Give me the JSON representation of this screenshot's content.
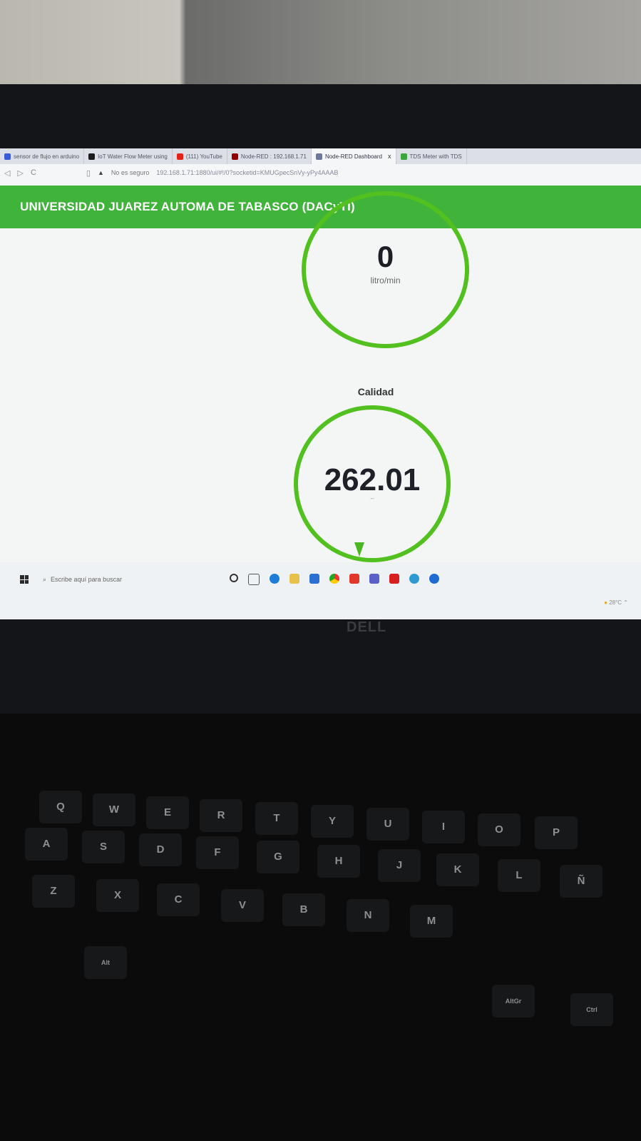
{
  "browser": {
    "tabs": [
      {
        "label": "sensor de flujo en arduino",
        "icon": "grid-icon",
        "color": "#3a5ad9"
      },
      {
        "label": "IoT Water Flow Meter using",
        "icon": "e-icon",
        "color": "#1b1b1b"
      },
      {
        "label": "(111) YouTube",
        "icon": "youtube-icon",
        "color": "#e62117"
      },
      {
        "label": "Node-RED : 192.168.1.71",
        "icon": "nodered-icon",
        "color": "#8f0000"
      },
      {
        "label": "Node-RED Dashboard",
        "icon": "share-icon",
        "color": "#6b7a99"
      },
      {
        "label": "TDS Meter with TDS",
        "icon": "dollar-icon",
        "color": "#3aa53a"
      }
    ],
    "active_tab_close": "x",
    "security_label": "No es seguro",
    "url": "192.168.1.71:1880/ui/#!/0?socketid=KMUGpecSnVy-yPy4AAAB"
  },
  "dashboard": {
    "header_title": "UNIVERSIDAD JUAREZ AUTOMA DE TABASCO (DACyTI)",
    "flow_gauge": {
      "value": "0",
      "unit": "litro/min"
    },
    "quality_gauge": {
      "title": "Calidad",
      "value": "262.01",
      "unit": "--"
    }
  },
  "taskbar": {
    "search_placeholder": "Escribe aquí para buscar",
    "temperature": "28°C"
  },
  "laptop": {
    "brand": "DELL"
  },
  "keyboard": {
    "keys": [
      "Q",
      "W",
      "E",
      "R",
      "T",
      "Y",
      "U",
      "I",
      "O",
      "P",
      "A",
      "S",
      "D",
      "F",
      "G",
      "H",
      "J",
      "K",
      "L",
      "Ñ",
      "Z",
      "X",
      "C",
      "V",
      "B",
      "N",
      "M",
      "Alt",
      "AltGr",
      "Ctrl"
    ]
  },
  "colors": {
    "accent": "#3fb33a",
    "gauge": "#52c11f"
  }
}
